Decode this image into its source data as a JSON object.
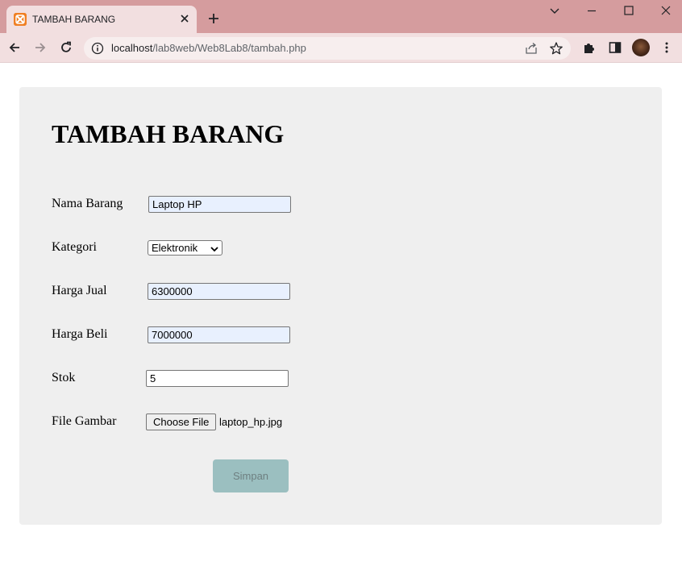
{
  "browser": {
    "tab_title": "TAMBAH BARANG",
    "url_host": "localhost",
    "url_path": "/lab8web/Web8Lab8/tambah.php",
    "icons": {
      "favicon": "xampp-icon",
      "tab_close": "close-icon",
      "new_tab": "plus-icon",
      "tab_search": "chevron-down-icon",
      "minimize": "minimize-icon",
      "maximize": "maximize-icon",
      "close_window": "close-icon",
      "back": "arrow-left-icon",
      "forward": "arrow-right-icon",
      "reload": "reload-icon",
      "site_info": "info-icon",
      "share": "share-icon",
      "bookmark": "star-icon",
      "extensions": "puzzle-icon",
      "side_panel": "side-panel-icon",
      "profile": "avatar",
      "menu": "kebab-menu-icon"
    },
    "colors": {
      "tabbar": "#d59c9e",
      "toolbar": "#f2dfe0"
    }
  },
  "form": {
    "heading": "TAMBAH BARANG",
    "nama_barang": {
      "label": "Nama Barang",
      "value": "Laptop HP"
    },
    "kategori": {
      "label": "Kategori",
      "selected": "Elektronik"
    },
    "harga_jual": {
      "label": "Harga Jual",
      "value": "6300000"
    },
    "harga_beli": {
      "label": "Harga Beli",
      "value": "7000000"
    },
    "stok": {
      "label": "Stok",
      "value": "5"
    },
    "file_gambar": {
      "label": "File Gambar",
      "button": "Choose File",
      "filename": "laptop_hp.jpg"
    },
    "submit_label": "Simpan",
    "colors": {
      "panel": "#efefef",
      "submit_bg": "#9bbfc0",
      "autofill_bg": "#e8f0fe"
    }
  }
}
